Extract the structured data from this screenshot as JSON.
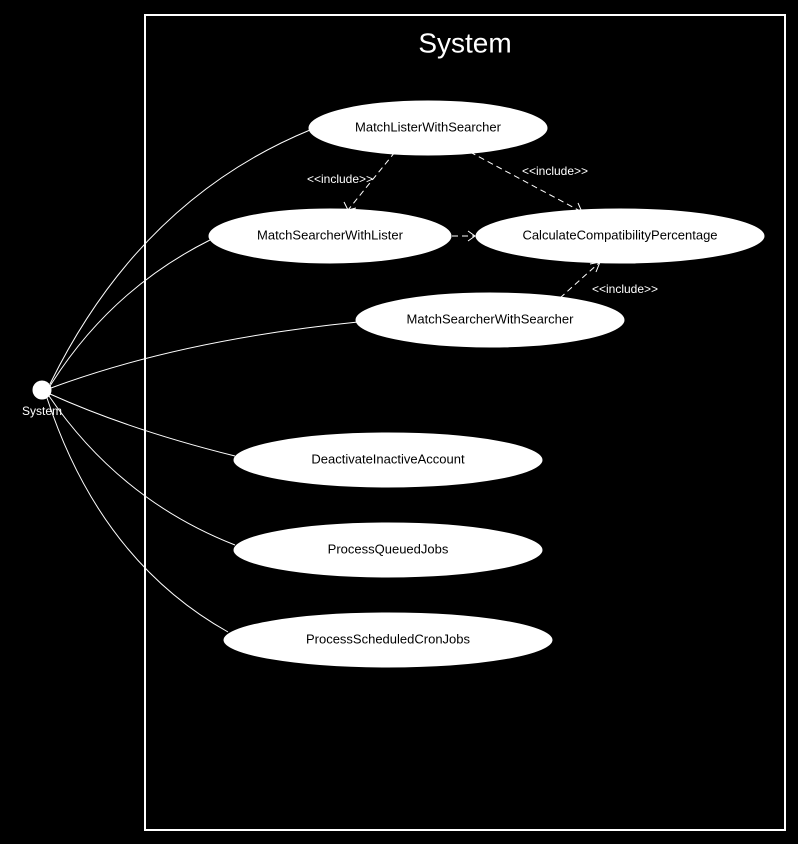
{
  "diagram": {
    "system_boundary_label": "System",
    "actor_label": "System",
    "usecases": {
      "uc1": "MatchListerWithSearcher",
      "uc2": "MatchSearcherWithLister",
      "uc3": "CalculateCompatibilityPercentage",
      "uc4": "MatchSearcherWithSearcher",
      "uc5": "DeactivateInactiveAccount",
      "uc6": "ProcessQueuedJobs",
      "uc7": "ProcessScheduledCronJobs"
    },
    "edge_labels": {
      "include12": "<<include>>",
      "include13": "<<include>>",
      "include23": "<<include>>",
      "include43": "<<include>>"
    }
  }
}
